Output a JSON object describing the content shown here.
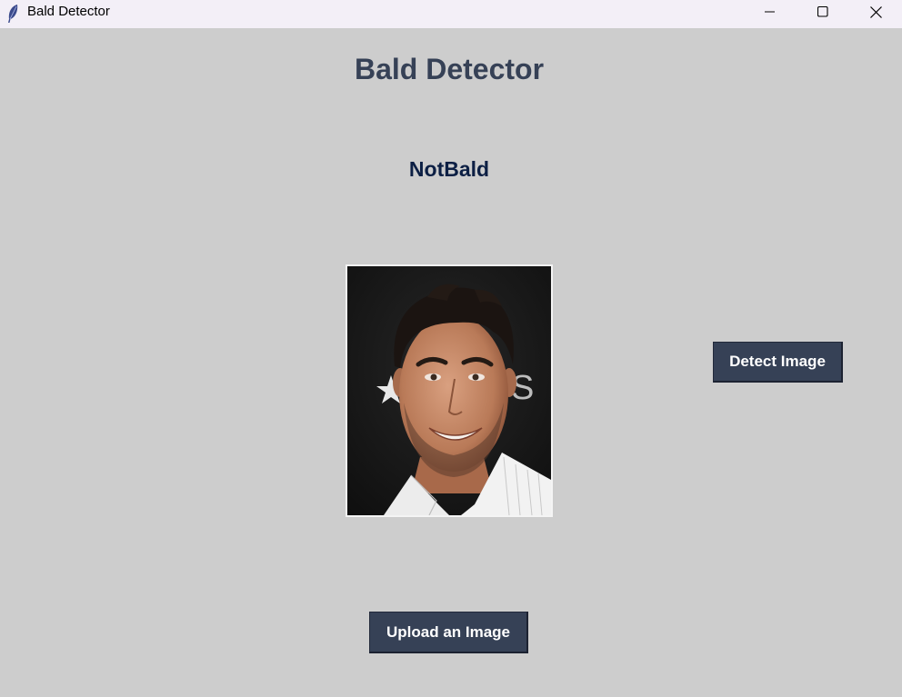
{
  "window": {
    "title": "Bald Detector",
    "icon": "feather-icon",
    "controls": [
      "minimize-icon",
      "maximize-icon",
      "close-icon"
    ]
  },
  "main": {
    "heading": "Bald Detector",
    "result": "NotBald",
    "detect_button": "Detect Image",
    "upload_button": "Upload an Image"
  },
  "colors": {
    "background": "#cdcdcd",
    "button": "#364156",
    "heading": "#364156",
    "result": "#0c1f44"
  }
}
